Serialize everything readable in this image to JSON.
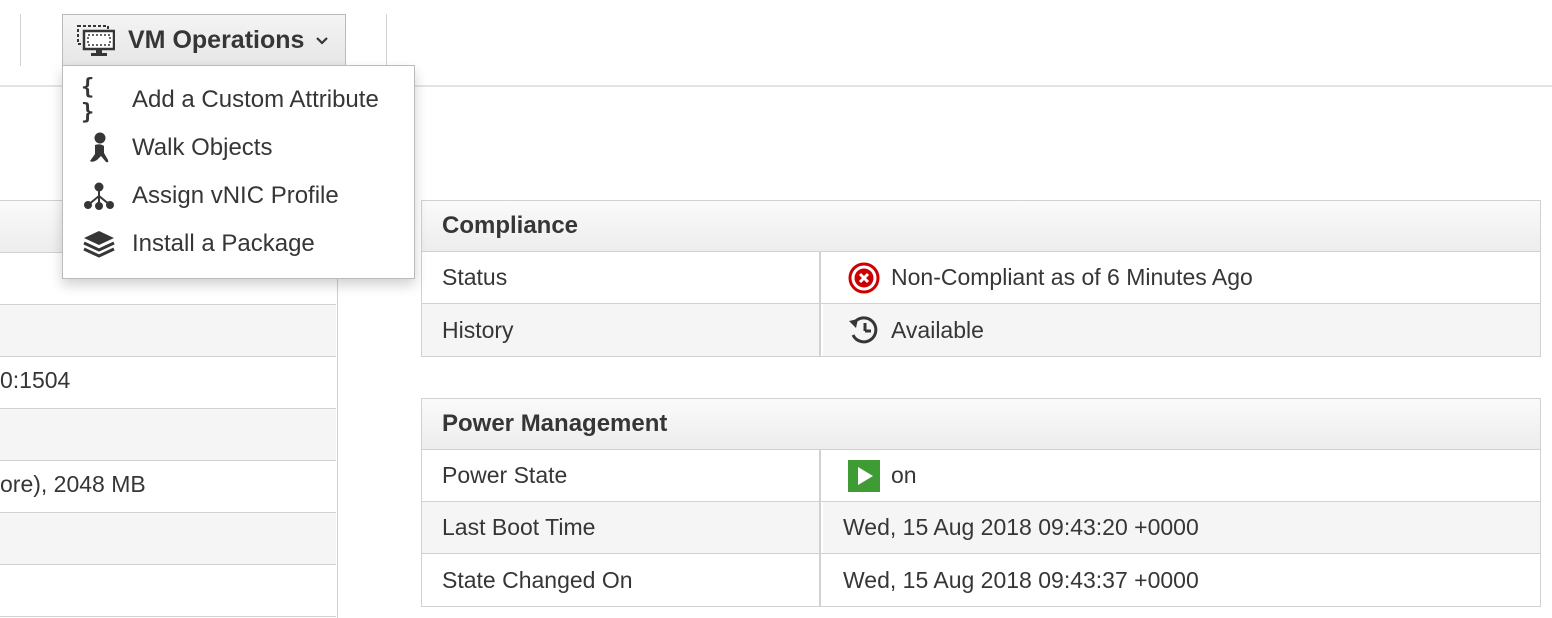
{
  "toolbar": {
    "vm_operations": {
      "label": "VM Operations",
      "icon": "vm-console-icon",
      "chevron": "chevron-down-icon",
      "menu": [
        {
          "label": "Add a Custom Attribute",
          "icon": "braces-icon"
        },
        {
          "label": "Walk Objects",
          "icon": "walking-person-icon"
        },
        {
          "label": "Assign vNIC Profile",
          "icon": "network-tree-icon"
        },
        {
          "label": "Install a Package",
          "icon": "layers-icon"
        }
      ]
    }
  },
  "left_table": {
    "rows": [
      "",
      "",
      "0:1504",
      "",
      "ore), 2048 MB",
      "",
      "",
      ""
    ]
  },
  "compliance": {
    "title": "Compliance",
    "rows": [
      {
        "key": "Status",
        "value": "Non-Compliant as of 6 Minutes Ago",
        "icon": "error-circle-icon"
      },
      {
        "key": "History",
        "value": "Available",
        "icon": "history-icon"
      }
    ]
  },
  "power": {
    "title": "Power Management",
    "rows": [
      {
        "key": "Power State",
        "value": "on",
        "icon": "play-icon"
      },
      {
        "key": "Last Boot Time",
        "value": "Wed, 15 Aug 2018 09:43:20 +0000"
      },
      {
        "key": "State Changed On",
        "value": "Wed, 15 Aug 2018 09:43:37 +0000"
      }
    ]
  },
  "colors": {
    "error": "#cc0000",
    "power_on": "#3f9c35",
    "border": "#d1d1d1",
    "text": "#363636"
  }
}
